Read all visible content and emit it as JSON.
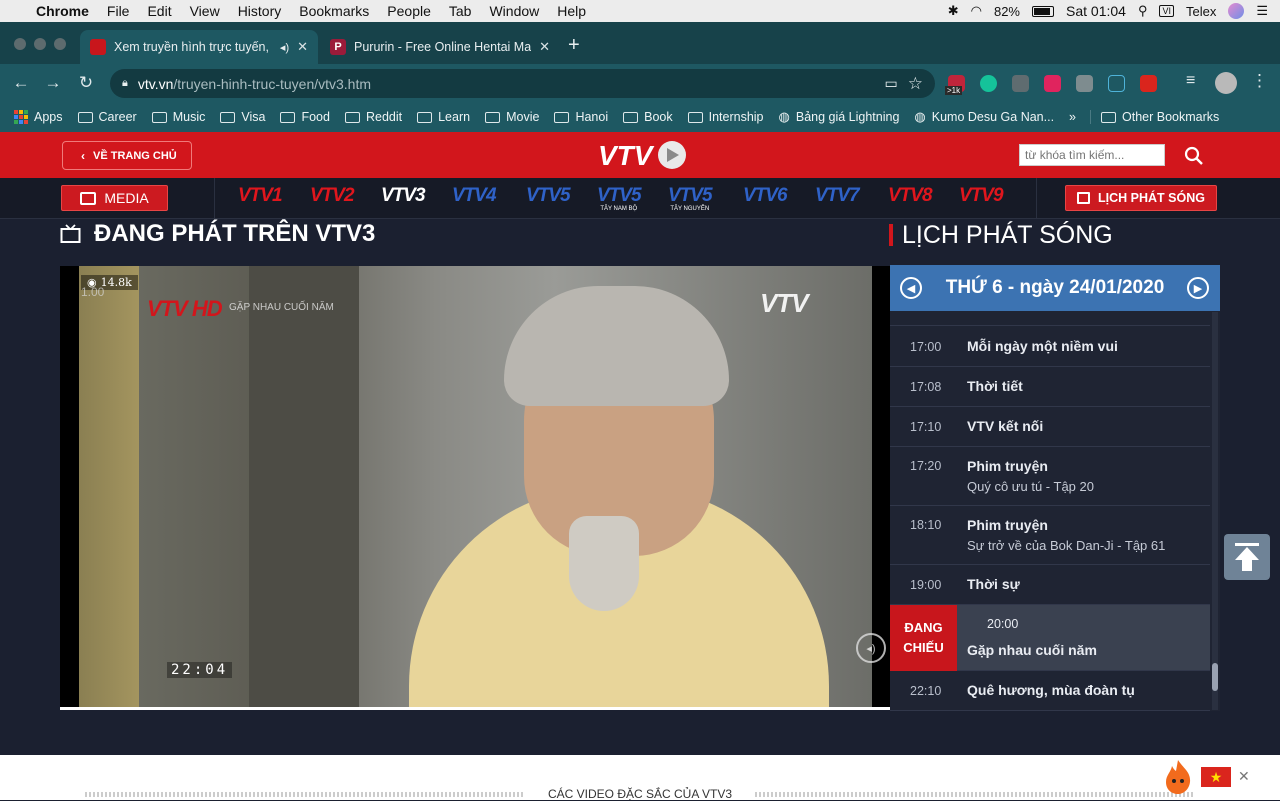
{
  "menubar": {
    "apple": "",
    "items": [
      "Chrome",
      "File",
      "Edit",
      "View",
      "History",
      "Bookmarks",
      "People",
      "Tab",
      "Window",
      "Help"
    ],
    "battery": "82%",
    "clock": "Sat 01:04",
    "input_source": "Telex"
  },
  "tabs": [
    {
      "title": "Xem truyền hình trực tuyến,",
      "favicon_color": "#c8161c"
    },
    {
      "title": "Pururin - Free Online Hentai Man",
      "favicon_color": "#9b1b3a",
      "favicon_letter": "P"
    }
  ],
  "new_tab_label": "+",
  "address": {
    "host": "vtv.vn",
    "path": "/truyen-hinh-truc-tuyen/vtv3.htm"
  },
  "extension_badge": ">1k",
  "bookmarks": {
    "items": [
      "Apps",
      "Career",
      "Music",
      "Visa",
      "Food",
      "Reddit",
      "Learn",
      "Movie",
      "Hanoi",
      "Book",
      "Internship",
      "Bảng giá Lightning",
      "Kumo Desu Ga Nan..."
    ],
    "overflow": "»",
    "other": "Other Bookmarks"
  },
  "site": {
    "home_label": "VỀ TRANG CHỦ",
    "search_placeholder": "từ khóa tìm kiếm...",
    "media_label": "MEDIA",
    "schedule_label": "LỊCH PHÁT SÓNG",
    "channels": [
      {
        "label": "VTV1",
        "color": "#e0161d"
      },
      {
        "label": "VTV2",
        "color": "#e0161d"
      },
      {
        "label": "VTV3",
        "color": "#ffffff"
      },
      {
        "label": "VTV4",
        "color": "#2f62c8"
      },
      {
        "label": "VTV5",
        "color": "#2f62c8"
      },
      {
        "label": "VTV5",
        "sub": "TÂY NAM BỘ",
        "color": "#2f62c8"
      },
      {
        "label": "VTV5",
        "sub": "TÂY NGUYÊN",
        "color": "#2f62c8"
      },
      {
        "label": "VTV6",
        "color": "#2f62c8"
      },
      {
        "label": "VTV7",
        "color": "#2f62c8"
      },
      {
        "label": "VTV8",
        "color": "#e0161d"
      },
      {
        "label": "VTV9",
        "color": "#e0161d"
      }
    ]
  },
  "live": {
    "heading": "ĐANG PHÁT TRÊN VTV3",
    "views": "14.8k",
    "speed": "1.00",
    "program_overlay": "GẶP NHAU CUỐI NĂM",
    "timestamp": "22:04",
    "watermark": "VTV",
    "channel_watermark": "VTV HD"
  },
  "schedule": {
    "heading": "LỊCH PHÁT SÓNG",
    "date": "THỨ 6 - ngày 24/01/2020",
    "live_badge": [
      "ĐANG",
      "CHIẾU"
    ],
    "rows": [
      {
        "time": "17:00",
        "name": "Mỗi ngày một niềm vui"
      },
      {
        "time": "17:08",
        "name": "Thời tiết"
      },
      {
        "time": "17:10",
        "name": "VTV kết nối"
      },
      {
        "time": "17:20",
        "name": "Phim truyện",
        "episode": "Quý cô ưu tú - Tập 20"
      },
      {
        "time": "18:10",
        "name": "Phim truyện",
        "episode": "Sự trở về của Bok Dan-Ji - Tập 61"
      },
      {
        "time": "19:00",
        "name": "Thời sự"
      },
      {
        "time": "20:00",
        "name": "Gặp nhau cuối năm",
        "live": true
      },
      {
        "time": "22:10",
        "name": "Quê hương, mùa đoàn tụ"
      }
    ]
  },
  "bottom": {
    "title": "CÁC VIDEO ĐẶC SẮC CỦA VTV3",
    "close": "✕"
  }
}
